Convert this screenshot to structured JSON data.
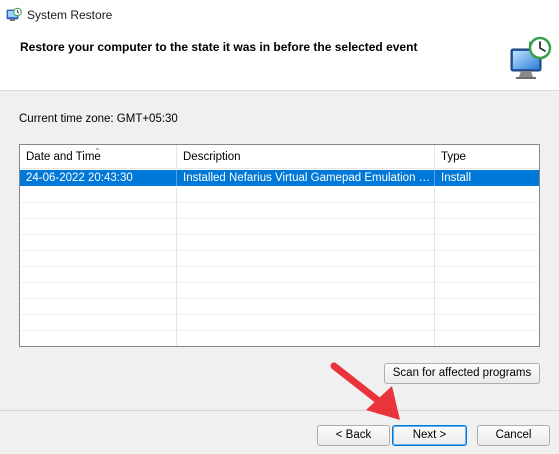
{
  "window": {
    "title": "System Restore"
  },
  "header": {
    "title": "Restore your computer to the state it was in before the selected event"
  },
  "timezone": {
    "label": "Current time zone: GMT+05:30"
  },
  "table": {
    "columns": [
      "Date and Time",
      "Description",
      "Type"
    ],
    "rows": [
      {
        "date": "24-06-2022 20:43:30",
        "description": "Installed Nefarius Virtual Gamepad Emulation Bus Driver",
        "type": "Install",
        "selected": true
      }
    ]
  },
  "buttons": {
    "scan": "Scan for affected programs",
    "back": "< Back",
    "next": "Next >",
    "cancel": "Cancel"
  },
  "colors": {
    "selection": "#0078d7",
    "annotation_arrow": "#e8343a"
  },
  "icons": {
    "app": "system-restore-icon",
    "header": "monitor-restore-icon",
    "annotation": "red-arrow-pointer"
  }
}
